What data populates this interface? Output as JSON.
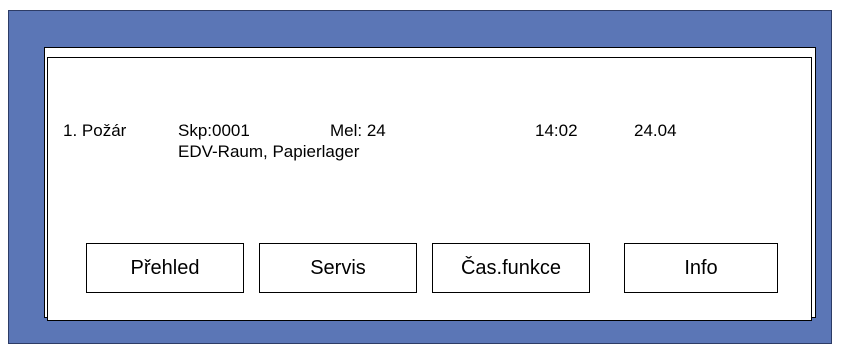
{
  "alarm": {
    "number": "1. Požár",
    "group": "Skp:0001",
    "detector": "Mel: 24",
    "time": "14:02",
    "date": "24.04",
    "location": "EDV-Raum, Papierlager"
  },
  "buttons": {
    "overview": "Přehled",
    "service": "Servis",
    "time_functions": "Čas.funkce",
    "info": "Info"
  },
  "colors": {
    "frame": "#5b76b6",
    "screen": "#ffffff"
  }
}
